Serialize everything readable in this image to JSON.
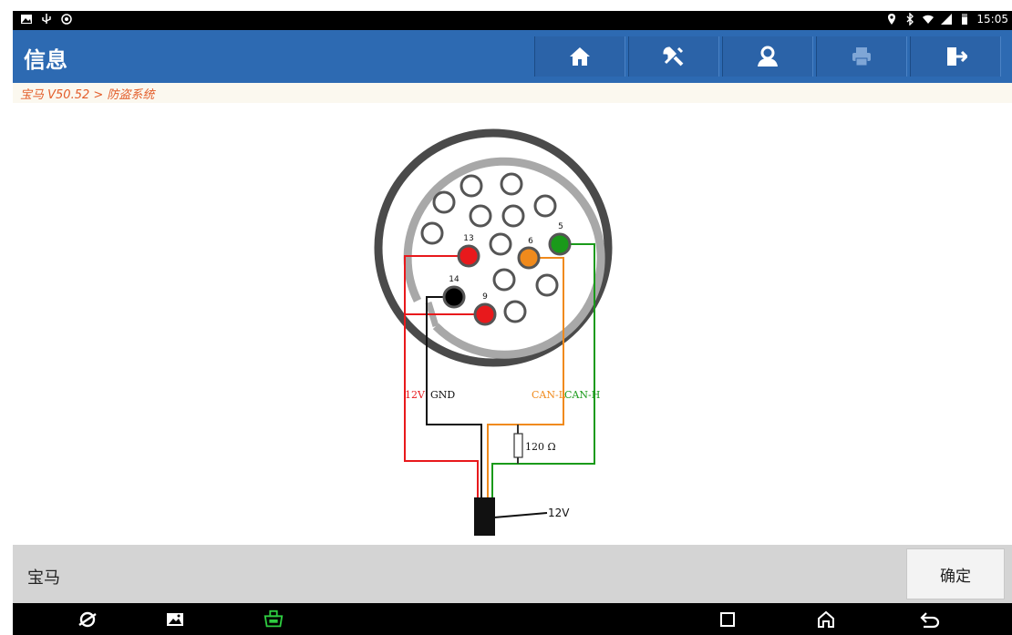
{
  "status_bar": {
    "time": "15:05",
    "left_icons": [
      "image-icon",
      "usb-icon",
      "debug-icon"
    ],
    "right_icons": [
      "location-icon",
      "bluetooth-icon",
      "wifi-icon",
      "signal-icon",
      "battery-icon"
    ]
  },
  "header": {
    "title": "信息",
    "toolbar": [
      "home-icon",
      "tools-icon",
      "user-icon",
      "print-icon",
      "exit-icon"
    ]
  },
  "breadcrumb": "宝马 V50.52 > 防盗系统",
  "diagram": {
    "pins": {
      "p13": "13",
      "p6": "6",
      "p5": "5",
      "p14": "14",
      "p9": "9"
    },
    "labels": {
      "v12": "12V",
      "gnd": "GND",
      "canl": "CAN-L",
      "canh": "CAN-H",
      "resistor": "120 Ω",
      "power": "12V"
    },
    "colors": {
      "red": "#e8191c",
      "orange": "#f08a1c",
      "green": "#1a9a1a",
      "black": "#000000"
    }
  },
  "footer": {
    "label": "宝马",
    "ok_button": "确定"
  },
  "navbar": [
    "browser-icon",
    "gallery-icon",
    "vci-icon",
    "recent-apps-icon",
    "home-nav-icon",
    "back-icon"
  ]
}
